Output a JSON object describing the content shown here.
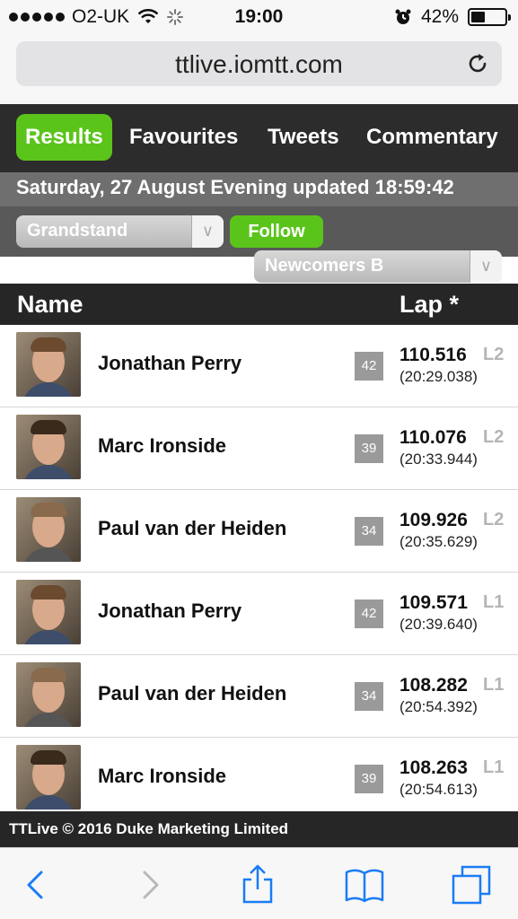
{
  "status_bar": {
    "carrier": "O2-UK",
    "time": "19:00",
    "battery": "42%",
    "battery_level": 0.42
  },
  "browser": {
    "url": "ttlive.iomtt.com"
  },
  "tabs": [
    {
      "label": "Results",
      "active": true
    },
    {
      "label": "Favourites",
      "active": false
    },
    {
      "label": "Tweets",
      "active": false
    },
    {
      "label": "Commentary",
      "active": false
    }
  ],
  "date_line": "Saturday, 27 August Evening updated 18:59:42",
  "controls": {
    "location_select": "Grandstand",
    "follow_label": "Follow",
    "class_select": "Newcomers B",
    "chevron": "∨"
  },
  "table": {
    "headers": {
      "name": "Name",
      "lap": "Lap *"
    },
    "rows": [
      {
        "name": "Jonathan Perry",
        "number": "42",
        "speed": "110.516",
        "lap": "L2",
        "time": "(20:29.038)"
      },
      {
        "name": "Marc Ironside",
        "number": "39",
        "speed": "110.076",
        "lap": "L2",
        "time": "(20:33.944)"
      },
      {
        "name": "Paul van der Heiden",
        "number": "34",
        "speed": "109.926",
        "lap": "L2",
        "time": "(20:35.629)"
      },
      {
        "name": "Jonathan Perry",
        "number": "42",
        "speed": "109.571",
        "lap": "L1",
        "time": "(20:39.640)"
      },
      {
        "name": "Paul van der Heiden",
        "number": "34",
        "speed": "108.282",
        "lap": "L1",
        "time": "(20:54.392)"
      },
      {
        "name": "Marc Ironside",
        "number": "39",
        "speed": "108.263",
        "lap": "L1",
        "time": "(20:54.613)"
      }
    ]
  },
  "footer": "TTLive © 2016 Duke Marketing Limited",
  "colors": {
    "accent_green": "#5bc41b",
    "header_dark": "#2c2c2c",
    "ios_blue": "#1a7cf5"
  },
  "icons": [
    "signal-dots-icon",
    "wifi-icon",
    "activity-spinner-icon",
    "alarm-icon",
    "battery-icon",
    "reload-icon",
    "back-icon",
    "forward-icon",
    "share-icon",
    "bookmarks-icon",
    "tabs-icon"
  ]
}
